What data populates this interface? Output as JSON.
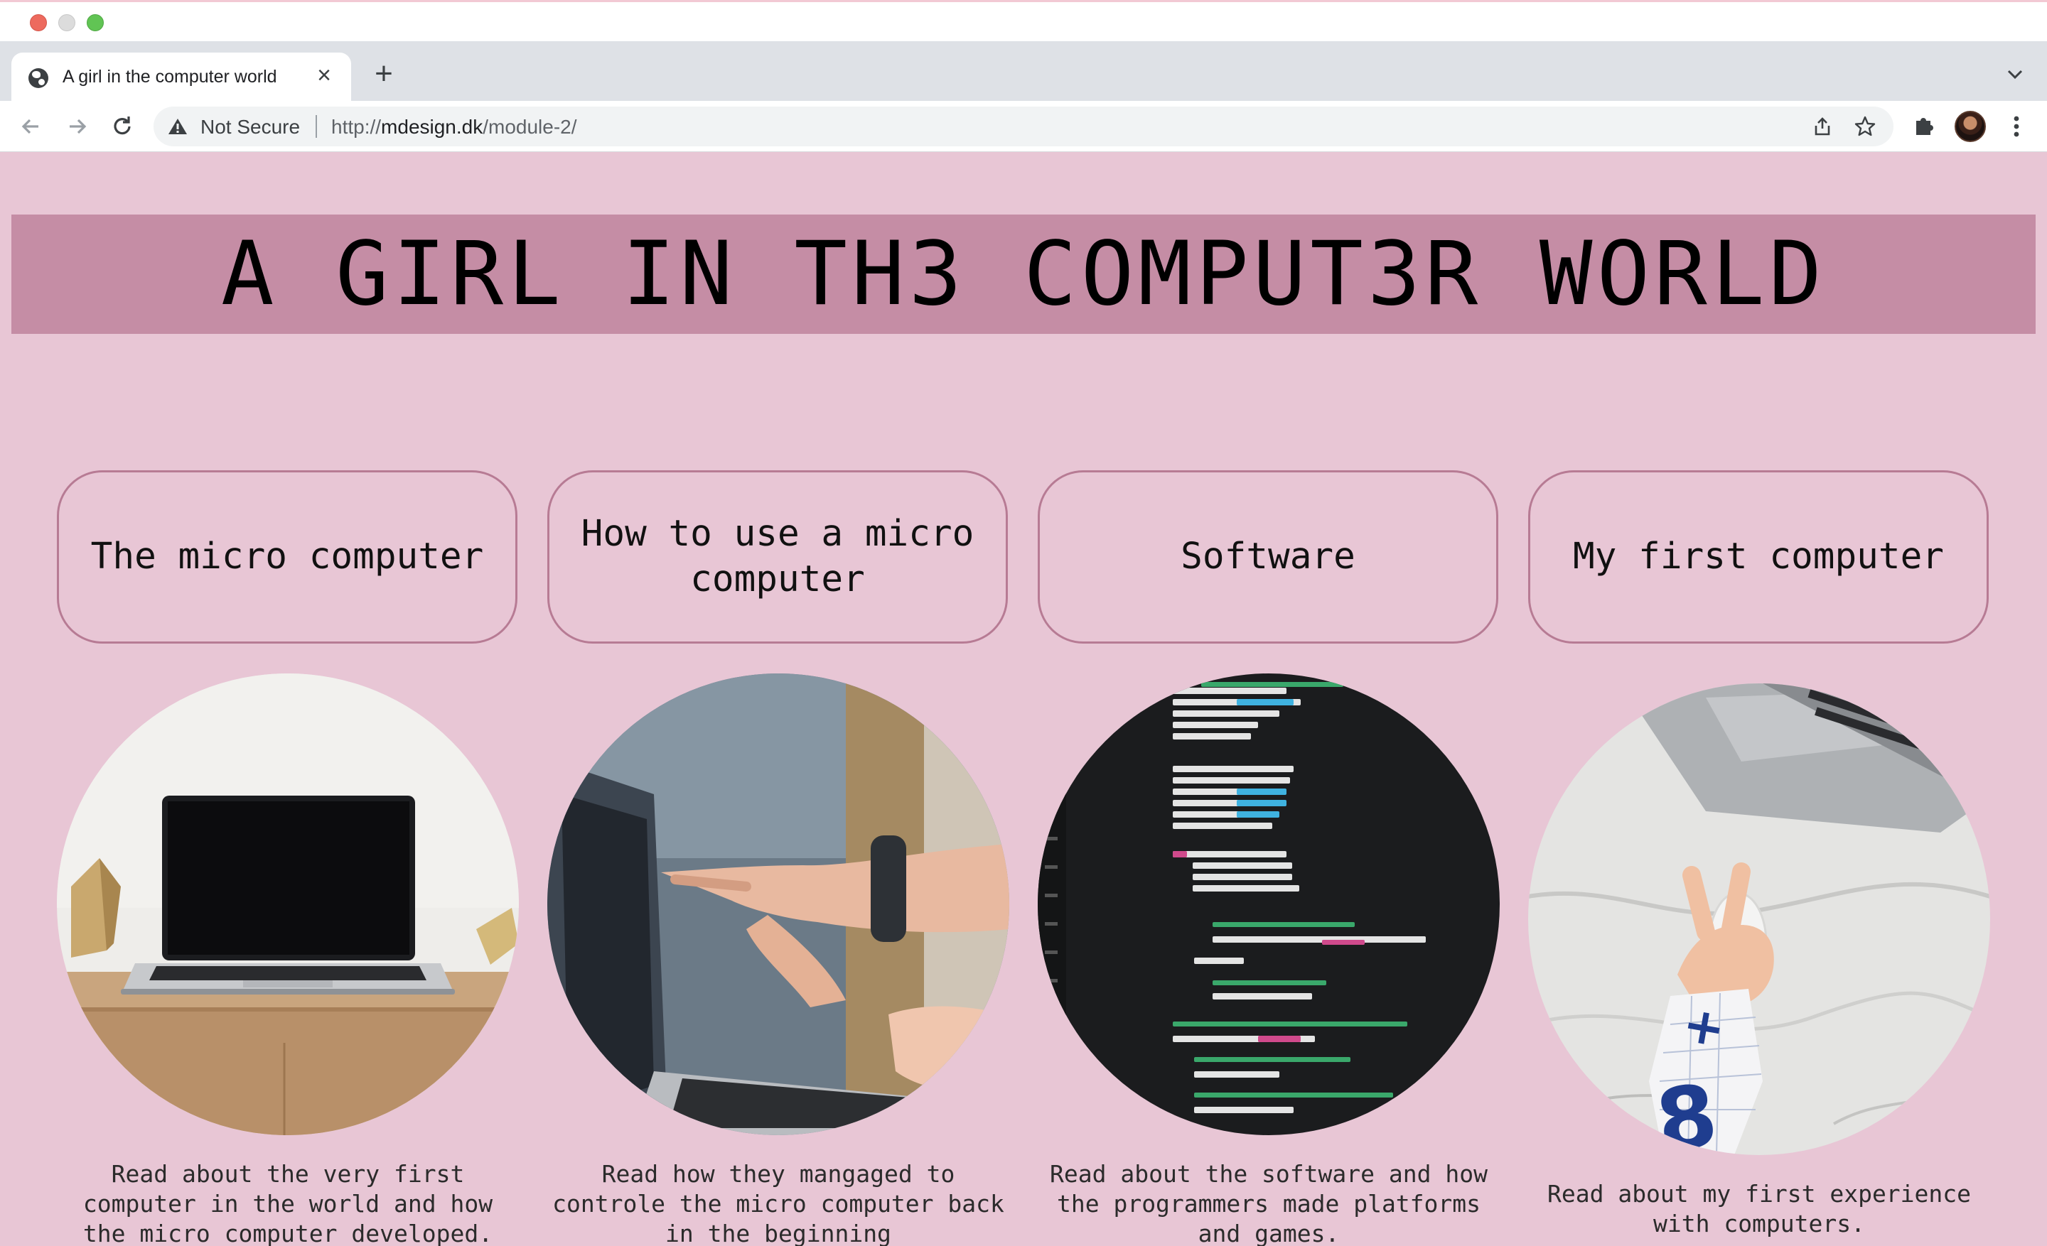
{
  "browser": {
    "tab_title": "A girl in the computer world",
    "tab_close": "×",
    "new_tab": "+",
    "security_label": "Not Secure",
    "url_scheme": "http://",
    "url_host": "mdesign.dk",
    "url_path": "/module-2/"
  },
  "site": {
    "title": "A GIRL IN TH3 COMPUT3R WORLD"
  },
  "cards": [
    {
      "label": "The micro computer",
      "description": "Read about the very first computer in the world and how the micro computer developed.",
      "image": "laptop-on-desk"
    },
    {
      "label": "How to use a micro computer",
      "description": "Read how they mangaged to controle the micro computer back in the beginning",
      "image": "pointing-at-laptop"
    },
    {
      "label": "Software",
      "description": "Read about the software and how the programmers made platforms and games.",
      "image": "code-on-screen"
    },
    {
      "label": "My first computer",
      "description": "Read about my first experience with computers.",
      "image": "child-hand-on-mouse"
    }
  ],
  "colors": {
    "page_bg": "#e8c6d5",
    "banner_bg": "#c58da5",
    "card_border": "#b77b94"
  }
}
